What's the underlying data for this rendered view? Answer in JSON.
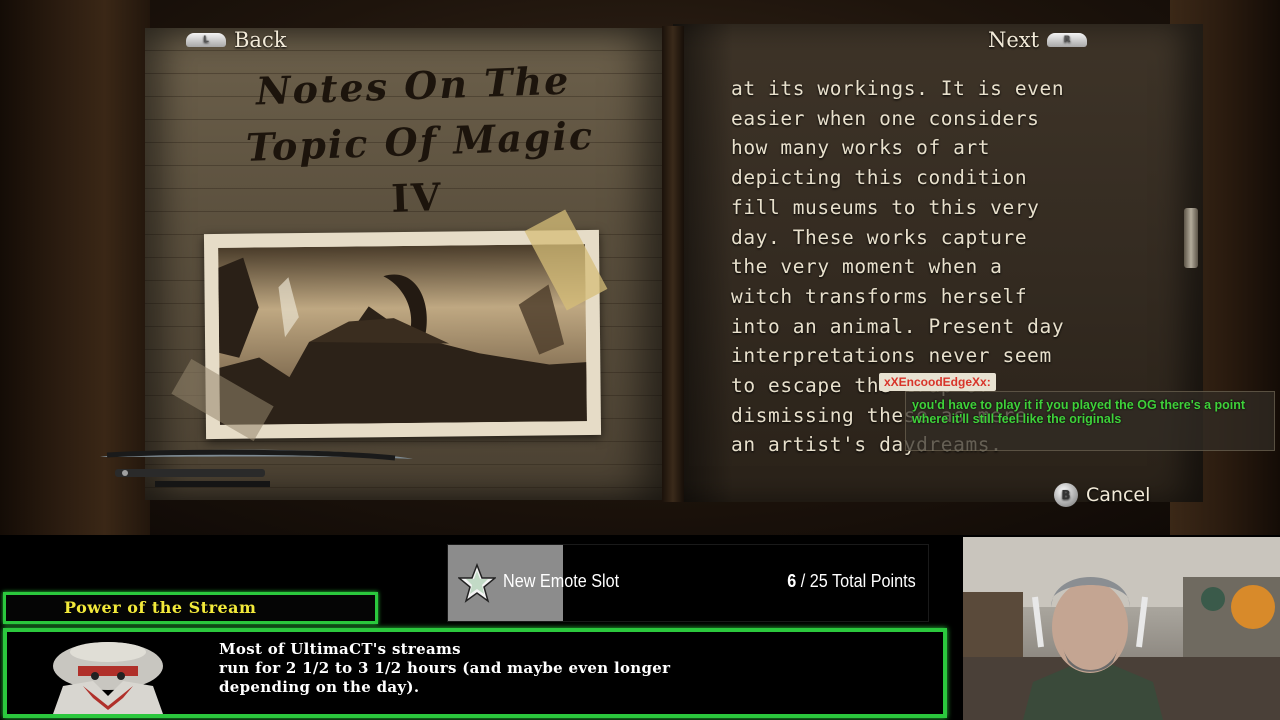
{
  "game": {
    "back_label": "Back",
    "back_shoulder": "L",
    "next_label": "Next",
    "next_shoulder": "R",
    "book_title_line1": "Notes On The",
    "book_title_line2": "Topic Of Magic",
    "book_title_line3": "IV",
    "page_text": [
      "at its workings. It is even",
      "easier when one considers",
      "how many works of art",
      "depicting this condition",
      "fill museums to this very",
      "day. These works capture",
      "the very moment when a",
      "witch transforms herself",
      "into an animal. Present day",
      "interpretations never seem",
      "to escape the trap of",
      "dismissing these as mere",
      "an artist's daydreams."
    ],
    "cancel_label": "Cancel",
    "cancel_button_glyph": "B"
  },
  "chat": {
    "username": "xXEncoodEdgeXx:",
    "message": "you'd have to play it if you played the OG there's a point where it'll still feel like the originals"
  },
  "points": {
    "label": "New Emote Slot",
    "current": "6",
    "total_text": " / 25 Total Points",
    "progress_fraction": 0.24
  },
  "power_of_the_stream": {
    "title": "Power of the Stream",
    "lines": [
      "Most of UltimaCT's streams",
      "run for 2 1/2 to 3 1/2 hours (and maybe even longer",
      "depending on the day)."
    ]
  },
  "colors": {
    "overlay_green": "#2bc83d",
    "header_yellow": "#f2e93a",
    "chat_green": "#3fd13a",
    "chat_name_red": "#d8342a"
  },
  "icons": [
    "star-icon",
    "l-shoulder-icon",
    "r-shoulder-icon",
    "b-button-icon"
  ]
}
